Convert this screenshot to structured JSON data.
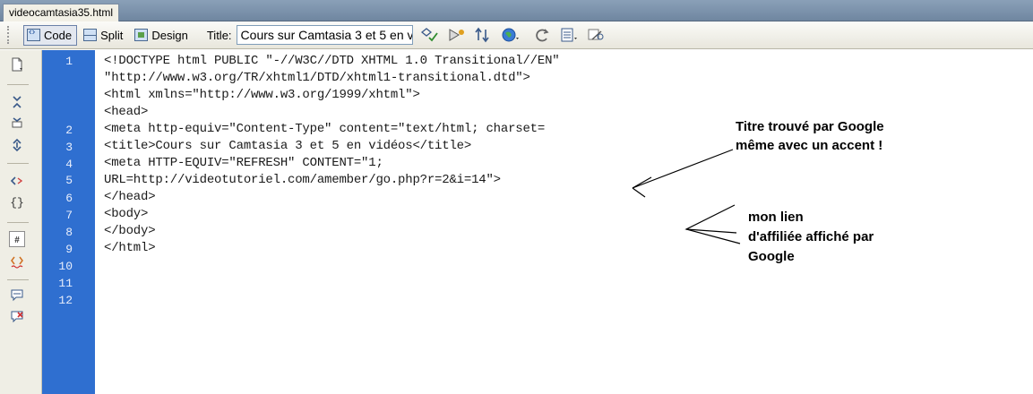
{
  "document_tab": {
    "label": "videocamtasia35.html"
  },
  "toolbar": {
    "views": [
      {
        "label": "Code",
        "icon": "code-view-icon",
        "active": true
      },
      {
        "label": "Split",
        "icon": "split-view-icon",
        "active": false
      },
      {
        "label": "Design",
        "icon": "design-view-icon",
        "active": false
      }
    ],
    "title_label": "Title:",
    "title_value": "Cours sur Camtasia 3 et 5 en vidéos",
    "icons": [
      "validate-icon",
      "live-view-icon",
      "file-management-icon",
      "preview-browser-icon",
      "refresh-icon",
      "view-options-icon",
      "visual-aids-icon"
    ]
  },
  "editor": {
    "gutter_color": "#2f6fd0",
    "line_numbers": [
      "1",
      "2",
      "3",
      "4",
      "5",
      "6",
      "7",
      "8",
      "9",
      "10",
      "11",
      "12"
    ],
    "lines": [
      "<!DOCTYPE html PUBLIC \"-//W3C//DTD XHTML 1.0 Transitional//EN\"",
      "\"http://www.w3.org/TR/xhtml1/DTD/xhtml1-transitional.dtd\">",
      "<html xmlns=\"http://www.w3.org/1999/xhtml\">",
      "<head>",
      "<meta http-equiv=\"Content-Type\" content=\"text/html; charset=",
      "<title>Cours sur Camtasia 3 et 5 en vidéos</title>",
      "<meta HTTP-EQUIV=\"REFRESH\" CONTENT=\"1;",
      "URL=http://videotutoriel.com/amember/go.php?r=2&i=14\">",
      "</head>",
      "<body>",
      "</body>",
      "</html>"
    ]
  },
  "annotations": {
    "title_note": [
      "Titre trouvé par Google",
      "même avec un accent !"
    ],
    "link_note": [
      "mon lien",
      "d'affiliée affiché par",
      "Google"
    ]
  }
}
